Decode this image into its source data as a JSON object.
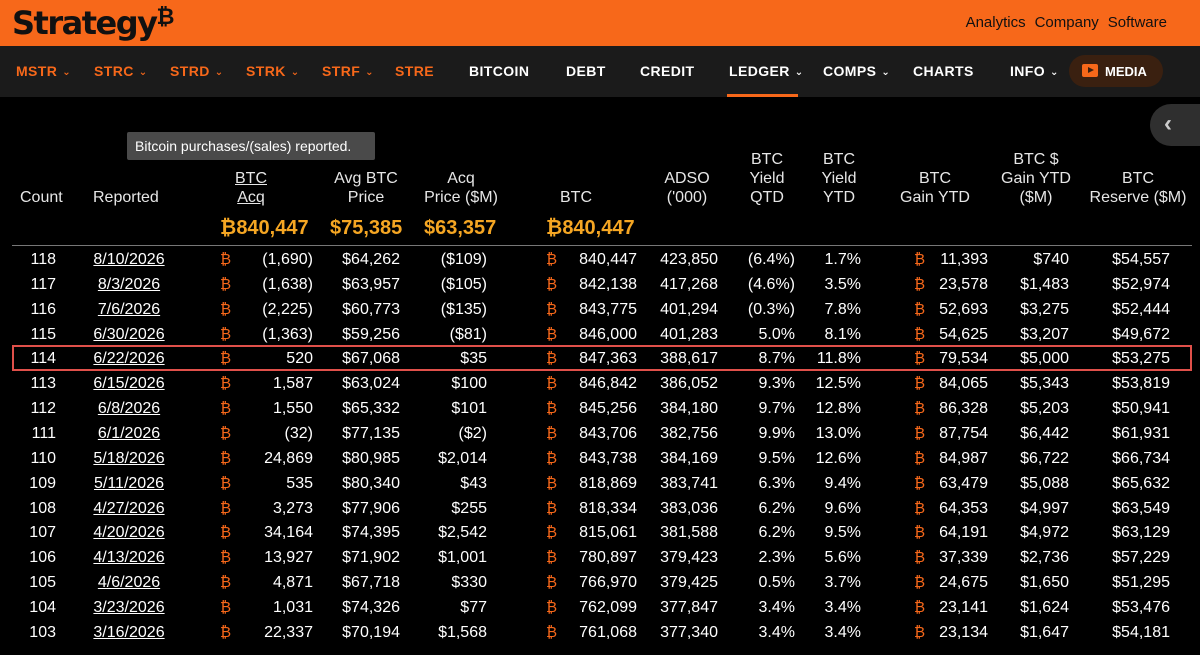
{
  "header": {
    "logo": "Strategy",
    "logo_mark": "₿",
    "links": [
      "Analytics",
      "Company",
      "Software"
    ]
  },
  "nav": {
    "items": [
      {
        "label": "MSTR",
        "chevron": true,
        "color": "orange"
      },
      {
        "label": "STRC",
        "chevron": true,
        "color": "orange"
      },
      {
        "label": "STRD",
        "chevron": true,
        "color": "orange"
      },
      {
        "label": "STRK",
        "chevron": true,
        "color": "orange"
      },
      {
        "label": "STRF",
        "chevron": true,
        "color": "orange"
      },
      {
        "label": "STRE",
        "chevron": false,
        "color": "orange"
      },
      {
        "label": "BITCOIN",
        "chevron": false,
        "color": "white"
      },
      {
        "label": "DEBT",
        "chevron": false,
        "color": "white"
      },
      {
        "label": "CREDIT",
        "chevron": false,
        "color": "white"
      },
      {
        "label": "LEDGER",
        "chevron": true,
        "color": "white",
        "active": true
      },
      {
        "label": "COMPS",
        "chevron": true,
        "color": "white"
      },
      {
        "label": "CHARTS",
        "chevron": false,
        "color": "white"
      },
      {
        "label": "INFO",
        "chevron": true,
        "color": "white"
      }
    ],
    "media_label": "MEDIA",
    "accent": "#f7681a"
  },
  "tooltip": "Bitcoin purchases/(sales) reported.",
  "columns": {
    "count": "Count",
    "reported": "Reported",
    "btc_acq": [
      "BTC",
      "Acq"
    ],
    "avg_price": [
      "Avg BTC",
      "Price"
    ],
    "acq_price": [
      "Acq",
      "Price ($M)"
    ],
    "btc": "BTC",
    "adso": [
      "ADSO",
      "('000)"
    ],
    "yield_qtd": [
      "BTC",
      "Yield",
      "QTD"
    ],
    "yield_ytd": [
      "BTC",
      "Yield",
      "YTD"
    ],
    "gain_ytd": [
      "BTC",
      "Gain YTD"
    ],
    "usd_gain": [
      "BTC $",
      "Gain YTD",
      "($M)"
    ],
    "reserve": [
      "BTC",
      "Reserve ($M)"
    ]
  },
  "totals": {
    "btc_acq": "840,447",
    "avg_price": "$75,385",
    "acq_price": "$63,357",
    "btc": "840,447"
  },
  "btc_symbol": "₿",
  "highlighted_row": 114,
  "rows": [
    {
      "count": "118",
      "date": "8/10/2026",
      "acq": "(1,690)",
      "avg": "$64,262",
      "price": "($109)",
      "btc": "840,447",
      "adso": "423,850",
      "qtd": "(6.4%)",
      "ytd": "1.7%",
      "gain": "11,393",
      "usd": "$740",
      "reserve": "$54,557"
    },
    {
      "count": "117",
      "date": "8/3/2026",
      "acq": "(1,638)",
      "avg": "$63,957",
      "price": "($105)",
      "btc": "842,138",
      "adso": "417,268",
      "qtd": "(4.6%)",
      "ytd": "3.5%",
      "gain": "23,578",
      "usd": "$1,483",
      "reserve": "$52,974"
    },
    {
      "count": "116",
      "date": "7/6/2026",
      "acq": "(2,225)",
      "avg": "$60,773",
      "price": "($135)",
      "btc": "843,775",
      "adso": "401,294",
      "qtd": "(0.3%)",
      "ytd": "7.8%",
      "gain": "52,693",
      "usd": "$3,275",
      "reserve": "$52,444"
    },
    {
      "count": "115",
      "date": "6/30/2026",
      "acq": "(1,363)",
      "avg": "$59,256",
      "price": "($81)",
      "btc": "846,000",
      "adso": "401,283",
      "qtd": "5.0%",
      "ytd": "8.1%",
      "gain": "54,625",
      "usd": "$3,207",
      "reserve": "$49,672"
    },
    {
      "count": "114",
      "date": "6/22/2026",
      "acq": "520",
      "avg": "$67,068",
      "price": "$35",
      "btc": "847,363",
      "adso": "388,617",
      "qtd": "8.7%",
      "ytd": "11.8%",
      "gain": "79,534",
      "usd": "$5,000",
      "reserve": "$53,275"
    },
    {
      "count": "113",
      "date": "6/15/2026",
      "acq": "1,587",
      "avg": "$63,024",
      "price": "$100",
      "btc": "846,842",
      "adso": "386,052",
      "qtd": "9.3%",
      "ytd": "12.5%",
      "gain": "84,065",
      "usd": "$5,343",
      "reserve": "$53,819"
    },
    {
      "count": "112",
      "date": "6/8/2026",
      "acq": "1,550",
      "avg": "$65,332",
      "price": "$101",
      "btc": "845,256",
      "adso": "384,180",
      "qtd": "9.7%",
      "ytd": "12.8%",
      "gain": "86,328",
      "usd": "$5,203",
      "reserve": "$50,941"
    },
    {
      "count": "111",
      "date": "6/1/2026",
      "acq": "(32)",
      "avg": "$77,135",
      "price": "($2)",
      "btc": "843,706",
      "adso": "382,756",
      "qtd": "9.9%",
      "ytd": "13.0%",
      "gain": "87,754",
      "usd": "$6,442",
      "reserve": "$61,931"
    },
    {
      "count": "110",
      "date": "5/18/2026",
      "acq": "24,869",
      "avg": "$80,985",
      "price": "$2,014",
      "btc": "843,738",
      "adso": "384,169",
      "qtd": "9.5%",
      "ytd": "12.6%",
      "gain": "84,987",
      "usd": "$6,722",
      "reserve": "$66,734"
    },
    {
      "count": "109",
      "date": "5/11/2026",
      "acq": "535",
      "avg": "$80,340",
      "price": "$43",
      "btc": "818,869",
      "adso": "383,741",
      "qtd": "6.3%",
      "ytd": "9.4%",
      "gain": "63,479",
      "usd": "$5,088",
      "reserve": "$65,632"
    },
    {
      "count": "108",
      "date": "4/27/2026",
      "acq": "3,273",
      "avg": "$77,906",
      "price": "$255",
      "btc": "818,334",
      "adso": "383,036",
      "qtd": "6.2%",
      "ytd": "9.6%",
      "gain": "64,353",
      "usd": "$4,997",
      "reserve": "$63,549"
    },
    {
      "count": "107",
      "date": "4/20/2026",
      "acq": "34,164",
      "avg": "$74,395",
      "price": "$2,542",
      "btc": "815,061",
      "adso": "381,588",
      "qtd": "6.2%",
      "ytd": "9.5%",
      "gain": "64,191",
      "usd": "$4,972",
      "reserve": "$63,129"
    },
    {
      "count": "106",
      "date": "4/13/2026",
      "acq": "13,927",
      "avg": "$71,902",
      "price": "$1,001",
      "btc": "780,897",
      "adso": "379,423",
      "qtd": "2.3%",
      "ytd": "5.6%",
      "gain": "37,339",
      "usd": "$2,736",
      "reserve": "$57,229"
    },
    {
      "count": "105",
      "date": "4/6/2026",
      "acq": "4,871",
      "avg": "$67,718",
      "price": "$330",
      "btc": "766,970",
      "adso": "379,425",
      "qtd": "0.5%",
      "ytd": "3.7%",
      "gain": "24,675",
      "usd": "$1,650",
      "reserve": "$51,295"
    },
    {
      "count": "104",
      "date": "3/23/2026",
      "acq": "1,031",
      "avg": "$74,326",
      "price": "$77",
      "btc": "762,099",
      "adso": "377,847",
      "qtd": "3.4%",
      "ytd": "3.4%",
      "gain": "23,141",
      "usd": "$1,624",
      "reserve": "$53,476"
    },
    {
      "count": "103",
      "date": "3/16/2026",
      "acq": "22,337",
      "avg": "$70,194",
      "price": "$1,568",
      "btc": "761,068",
      "adso": "377,340",
      "qtd": "3.4%",
      "ytd": "3.4%",
      "gain": "23,134",
      "usd": "$1,647",
      "reserve": "$54,181"
    }
  ]
}
